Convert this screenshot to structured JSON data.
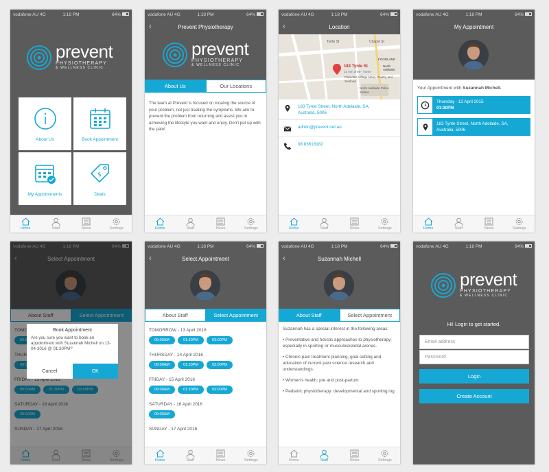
{
  "status": {
    "carrier": "vodafone AU",
    "network": "4G",
    "time": "1:18 PM",
    "battery": "64%"
  },
  "brand": {
    "name": "prevent",
    "line1": "PHYSIOTHERAPY",
    "line2": "& WELLNESS CLINIC",
    "accent": "#16a8d4",
    "dark": "#5b5b5b"
  },
  "tabs": {
    "home": "Home",
    "staff": "Staff",
    "news": "News",
    "settings": "Settings"
  },
  "home": {
    "tiles": [
      {
        "label": "About Us",
        "icon": "info-icon"
      },
      {
        "label": "Book Appointment",
        "icon": "calendar-icon"
      },
      {
        "label": "My Appointments",
        "icon": "calendar-check-icon"
      },
      {
        "label": "Deals",
        "icon": "tag-icon"
      }
    ]
  },
  "about": {
    "title": "Prevent Physiotherapy",
    "tab_about": "About Us",
    "tab_locations": "Our Locations",
    "text": "The team at Prevent is focused on locating the source of your problem, not just treating the symptoms. We aim to prevent the problem from returning and assist you in achieving the lifestyle you want and enjoy. Don't put up with the pain!"
  },
  "location": {
    "title": "Location",
    "map_pin": "183 Tynte St",
    "map_sub": "22 min drive - home",
    "map_labels": {
      "street": "Tynte St",
      "chapel": "Chapel St",
      "foodland": "FOODLAND",
      "palmdale": "Palmdale Village Meat, Poultry and Seafood",
      "north_adelaide": "North Adelaide",
      "police": "North Adelaide Police Station"
    },
    "address": "183 Tynte Street, North Adelaide, SA, Australia, 5006",
    "email": "admin@prevent.net.au",
    "phone": "08 83618182"
  },
  "my_appt": {
    "title": "My Appointment",
    "intro": "Your Appointment with",
    "person": "Suzannah Michell.",
    "date": "Thursday - 13 April 2015",
    "time": "01:30PM",
    "address": "183 Tynte Street, North Adelaide, SA, Australia, 5006"
  },
  "select": {
    "title": "Select Appointment",
    "tab_staff": "About Staff",
    "tab_select": "Select Appointment",
    "days": [
      {
        "label": "TOMORROW - 13 April 2016",
        "times": [
          "09:00AM",
          "01:30PM",
          "03:00PM"
        ]
      },
      {
        "label": "THURSDAY - 14 April 2016",
        "times": [
          "09:00AM",
          "01:30PM",
          "03:00PM"
        ]
      },
      {
        "label": "FRIDAY - 15 April 2016",
        "times": [
          "09:00AM",
          "01:30PM",
          "03:00PM"
        ]
      },
      {
        "label": "SATURDAY - 16 April 2016",
        "times": [
          "09:00AM"
        ]
      },
      {
        "label": "SUNDAY - 17 April 2016",
        "times": []
      }
    ]
  },
  "dialog": {
    "title": "Book Appointment",
    "message": "Are you sure you want to book an appointment with Suzannah Michell on 13-04-2016 @ 01:30PM?",
    "cancel": "Cancel",
    "ok": "OK"
  },
  "staff": {
    "title": "Suzannah Michell",
    "intro": "Suzannah has a special interest in the following areas:",
    "items": [
      "• Preventative and holistic approaches to physiotherapy; especially in sporting or musculoskeletal arenas.",
      "• Chronic pain treatment planning, goal setting and education of current pain science research and understandings.",
      "• Women's health; pre and post-partum",
      "• Pediatric physiotherapy: developmental and sporting.ing"
    ]
  },
  "login": {
    "greeting": "Hi! Login to get started.",
    "email_placeholder": "Email address",
    "password_placeholder": "Password",
    "login": "Login",
    "create": "Create Account"
  }
}
